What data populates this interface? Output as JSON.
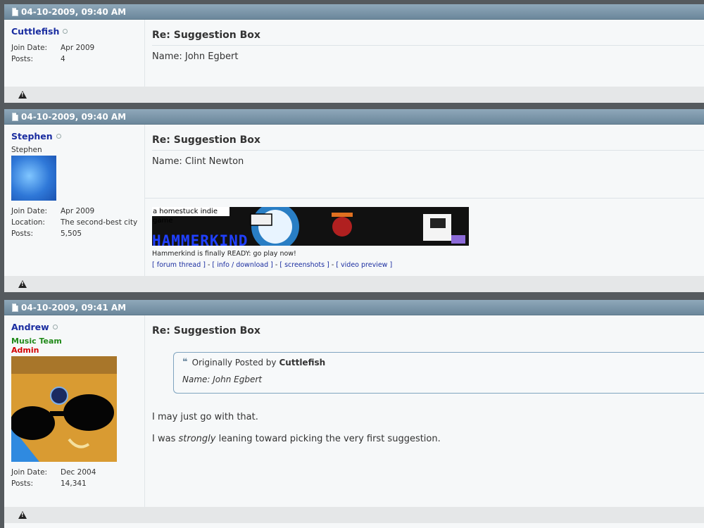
{
  "posts": [
    {
      "date": "04-10-2009, 09:40 AM",
      "username": "Cuttlefish",
      "join_label": "Join Date:",
      "join_date": "Apr 2009",
      "posts_label": "Posts:",
      "posts_count": "4",
      "title": "Re: Suggestion Box",
      "message": "Name: John Egbert"
    },
    {
      "date": "04-10-2009, 09:40 AM",
      "username": "Stephen",
      "usertitle": "Stephen",
      "join_label": "Join Date:",
      "join_date": "Apr 2009",
      "location_label": "Location:",
      "location": "The second-best city",
      "posts_label": "Posts:",
      "posts_count": "5,505",
      "title": "Re: Suggestion Box",
      "message": "Name: Clint Newton",
      "signature": {
        "banner_top": "a homestuck indie game",
        "banner_logo": "HAMMERKIND",
        "text": "Hammerkind is finally READY: go play now!",
        "links": [
          "[ forum thread ]",
          "[ info / download ]",
          "[ screenshots ]",
          "[ video preview ]"
        ],
        "sep": " - "
      }
    },
    {
      "date": "04-10-2009, 09:41 AM",
      "username": "Andrew",
      "group1": "Music Team",
      "group2": "Admin",
      "join_label": "Join Date:",
      "join_date": "Dec 2004",
      "posts_label": "Posts:",
      "posts_count": "14,341",
      "title": "Re: Suggestion Box",
      "quote": {
        "prefix": "Originally Posted by",
        "author": "Cuttlefish",
        "text": "Name: John Egbert"
      },
      "message_line1": "I may just go with that.",
      "message_line2_a": "I was ",
      "message_line2_em": "strongly",
      "message_line2_b": " leaning toward picking the very first suggestion."
    }
  ],
  "colors": {
    "header": "#7d97ab",
    "username": "#1a2da0",
    "group_music": "#218a1a",
    "group_admin": "#d40000"
  }
}
